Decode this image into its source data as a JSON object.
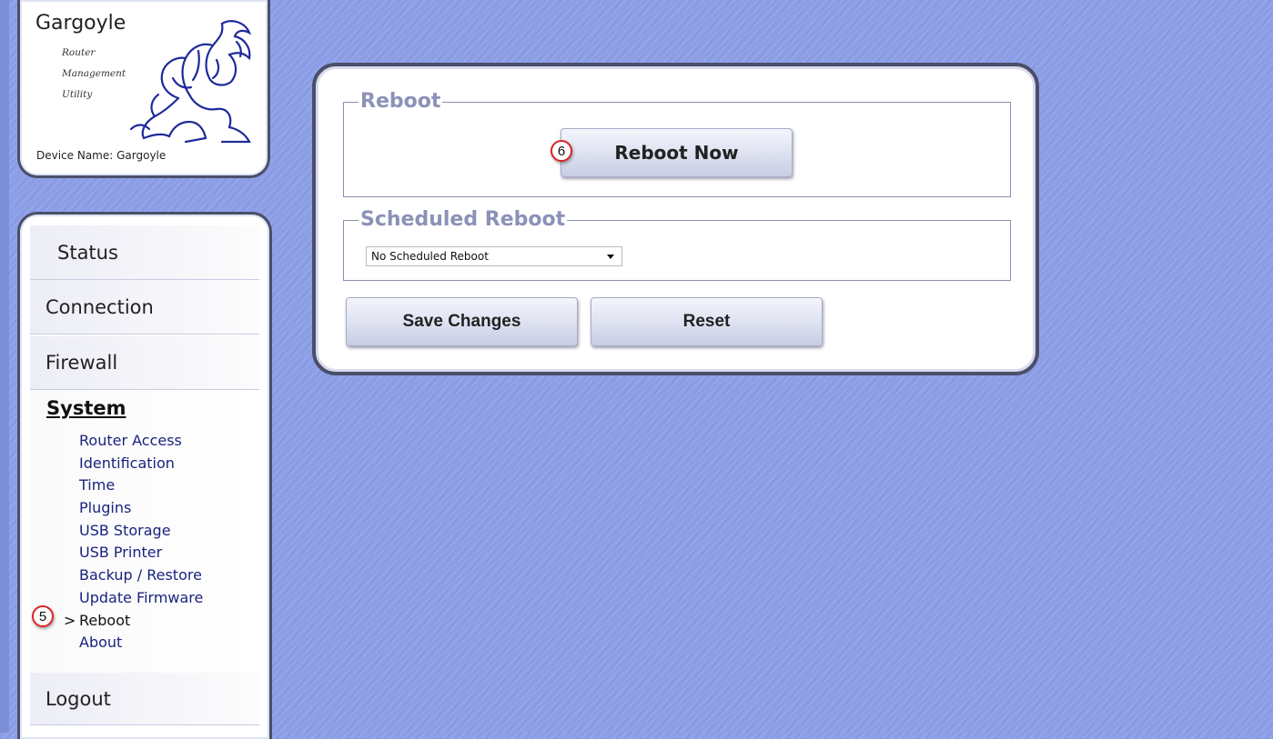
{
  "logo": {
    "title": "Gargoyle",
    "subtitle_lines": [
      "Router",
      "Management",
      "Utility"
    ],
    "device_name": "Device Name: Gargoyle"
  },
  "nav": {
    "status": "Status",
    "connection": "Connection",
    "firewall": "Firewall",
    "system": "System",
    "system_items": [
      "Router Access",
      "Identification",
      "Time",
      "Plugins",
      "USB Storage",
      "USB Printer",
      "Backup / Restore",
      "Update Firmware",
      "Reboot",
      "About"
    ],
    "active_marker": ">",
    "logout": "Logout"
  },
  "annotations": {
    "step5": "5",
    "step6": "6"
  },
  "reboot_section": {
    "legend": "Reboot",
    "button": "Reboot Now"
  },
  "scheduled_section": {
    "legend": "Scheduled Reboot",
    "select_value": "No Scheduled Reboot"
  },
  "actions": {
    "save": "Save Changes",
    "reset": "Reset"
  },
  "colors": {
    "background": "#8c9ee6",
    "legend": "#8c91b8",
    "link": "#1a237e",
    "badge_ring": "#dd2222"
  }
}
